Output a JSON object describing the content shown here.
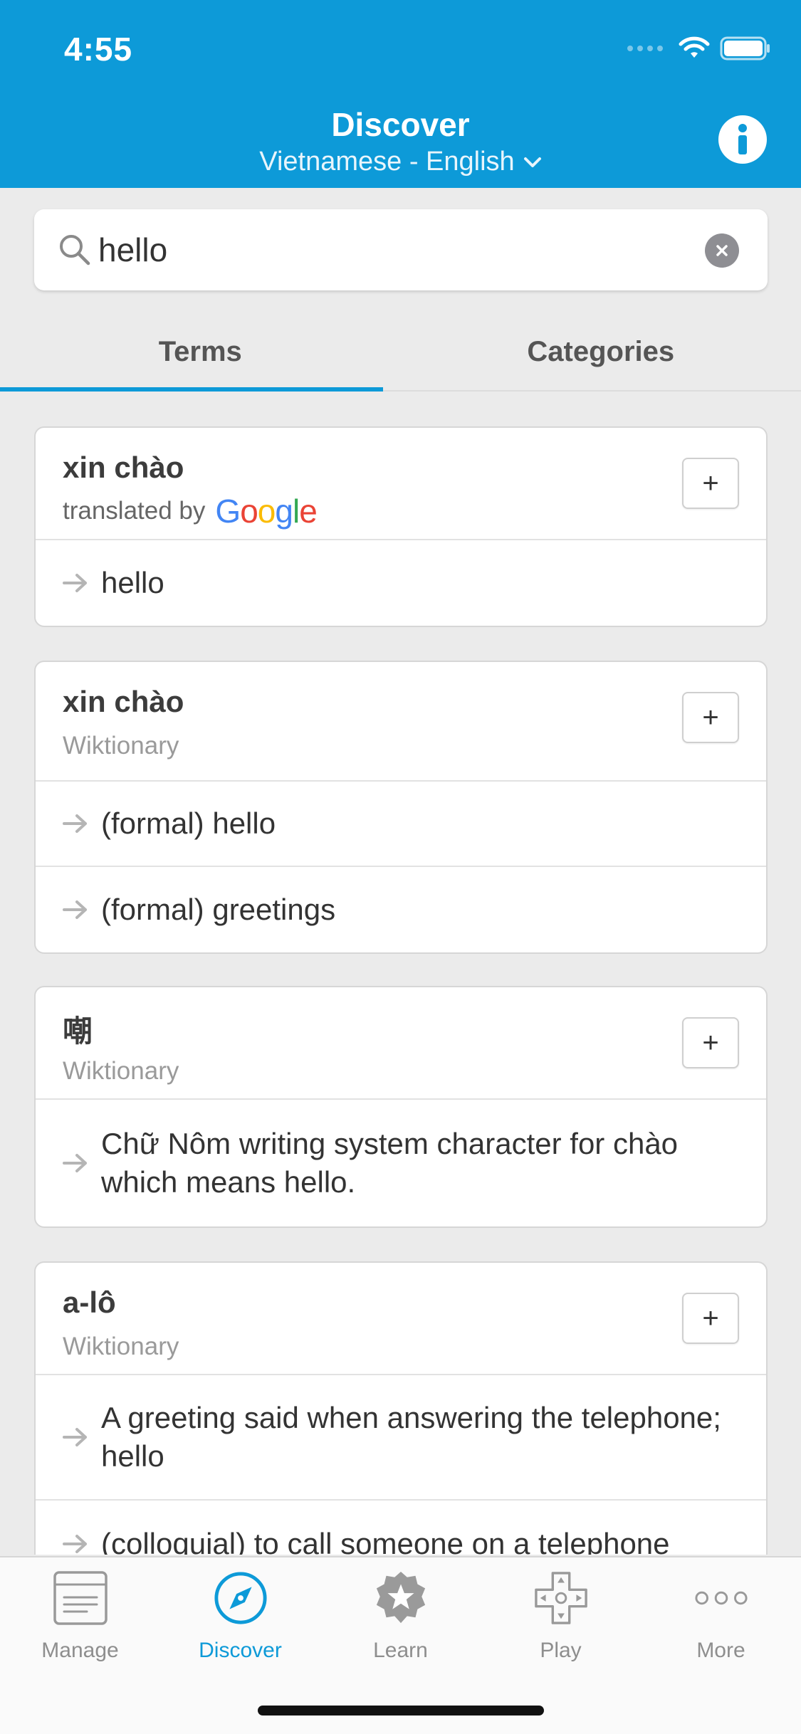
{
  "status_bar": {
    "time": "4:55"
  },
  "header": {
    "title": "Discover",
    "language_pair": "Vietnamese - English",
    "accent_color": "#0d9ad8"
  },
  "search": {
    "value": "hello",
    "placeholder": "Search"
  },
  "tabs": [
    {
      "label": "Terms",
      "selected": true
    },
    {
      "label": "Categories",
      "selected": false
    }
  ],
  "results": [
    {
      "term": "xin chào",
      "source_prefix": "translated by",
      "source_brand": "Google",
      "add_label": "+",
      "definitions": [
        "hello"
      ]
    },
    {
      "term": "xin chào",
      "source": "Wiktionary",
      "add_label": "+",
      "definitions": [
        "(formal) hello",
        "(formal) greetings"
      ]
    },
    {
      "term": "嘲",
      "source": "Wiktionary",
      "add_label": "+",
      "definitions": [
        "Chữ Nôm writing system character for chào which means hello."
      ]
    },
    {
      "term": "a-lô",
      "source": "Wiktionary",
      "add_label": "+",
      "definitions": [
        "A greeting said when answering the telephone; hello",
        "(colloquial) to call someone on a telephone"
      ]
    }
  ],
  "tabbar": [
    {
      "label": "Manage",
      "icon": "manage-icon",
      "active": false
    },
    {
      "label": "Discover",
      "icon": "compass-icon",
      "active": true
    },
    {
      "label": "Learn",
      "icon": "badge-star-icon",
      "active": false
    },
    {
      "label": "Play",
      "icon": "dpad-icon",
      "active": false
    },
    {
      "label": "More",
      "icon": "more-dots-icon",
      "active": false
    }
  ]
}
